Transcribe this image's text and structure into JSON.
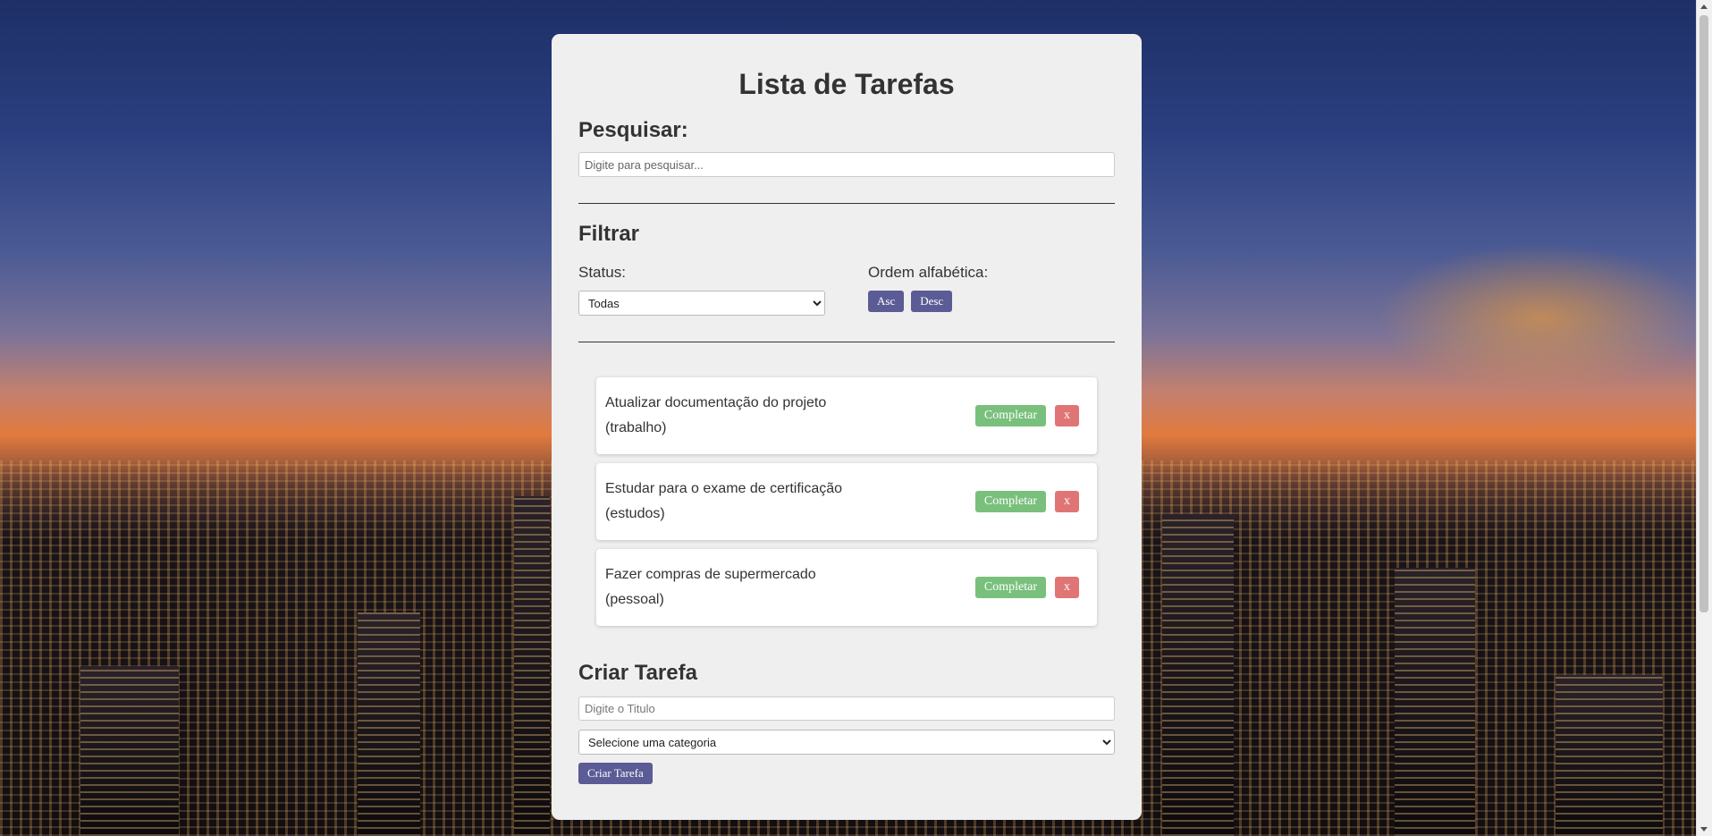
{
  "page": {
    "title": "Lista de Tarefas"
  },
  "search": {
    "heading": "Pesquisar:",
    "placeholder": "Digite para pesquisar...",
    "value": ""
  },
  "filter": {
    "heading": "Filtrar",
    "status_label": "Status:",
    "status_selected": "Todas",
    "sort_label": "Ordem alfabética:",
    "asc_label": "Asc",
    "desc_label": "Desc"
  },
  "tasks": [
    {
      "title": "Atualizar documentação do projeto",
      "category": "(trabalho)",
      "complete_label": "Completar",
      "delete_label": "x"
    },
    {
      "title": "Estudar para o exame de certificação",
      "category": "(estudos)",
      "complete_label": "Completar",
      "delete_label": "x"
    },
    {
      "title": "Fazer compras de supermercado",
      "category": "(pessoal)",
      "complete_label": "Completar",
      "delete_label": "x"
    }
  ],
  "create": {
    "heading": "Criar Tarefa",
    "title_placeholder": "Digite o Titulo",
    "category_selected": "Selecione uma categoria",
    "submit_label": "Criar Tarefa"
  },
  "colors": {
    "primary_button": "#5b5b96",
    "complete_button": "#79c07c",
    "delete_button": "#e07575",
    "card_background": "#efefef"
  }
}
